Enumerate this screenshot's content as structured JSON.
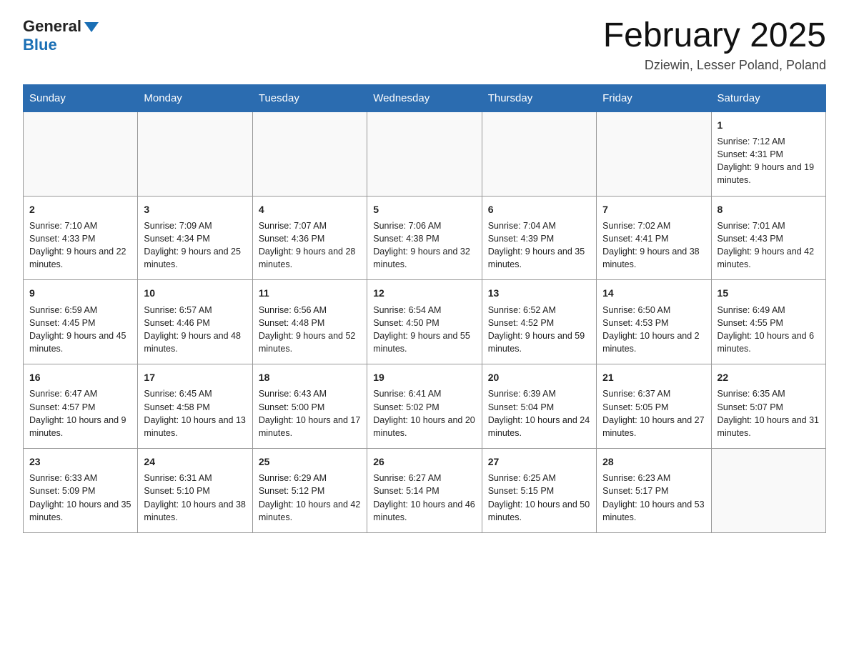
{
  "logo": {
    "top": "General",
    "bottom": "Blue"
  },
  "title": "February 2025",
  "subtitle": "Dziewin, Lesser Poland, Poland",
  "days_of_week": [
    "Sunday",
    "Monday",
    "Tuesday",
    "Wednesday",
    "Thursday",
    "Friday",
    "Saturday"
  ],
  "weeks": [
    [
      {
        "day": "",
        "info": ""
      },
      {
        "day": "",
        "info": ""
      },
      {
        "day": "",
        "info": ""
      },
      {
        "day": "",
        "info": ""
      },
      {
        "day": "",
        "info": ""
      },
      {
        "day": "",
        "info": ""
      },
      {
        "day": "1",
        "info": "Sunrise: 7:12 AM\nSunset: 4:31 PM\nDaylight: 9 hours and 19 minutes."
      }
    ],
    [
      {
        "day": "2",
        "info": "Sunrise: 7:10 AM\nSunset: 4:33 PM\nDaylight: 9 hours and 22 minutes."
      },
      {
        "day": "3",
        "info": "Sunrise: 7:09 AM\nSunset: 4:34 PM\nDaylight: 9 hours and 25 minutes."
      },
      {
        "day": "4",
        "info": "Sunrise: 7:07 AM\nSunset: 4:36 PM\nDaylight: 9 hours and 28 minutes."
      },
      {
        "day": "5",
        "info": "Sunrise: 7:06 AM\nSunset: 4:38 PM\nDaylight: 9 hours and 32 minutes."
      },
      {
        "day": "6",
        "info": "Sunrise: 7:04 AM\nSunset: 4:39 PM\nDaylight: 9 hours and 35 minutes."
      },
      {
        "day": "7",
        "info": "Sunrise: 7:02 AM\nSunset: 4:41 PM\nDaylight: 9 hours and 38 minutes."
      },
      {
        "day": "8",
        "info": "Sunrise: 7:01 AM\nSunset: 4:43 PM\nDaylight: 9 hours and 42 minutes."
      }
    ],
    [
      {
        "day": "9",
        "info": "Sunrise: 6:59 AM\nSunset: 4:45 PM\nDaylight: 9 hours and 45 minutes."
      },
      {
        "day": "10",
        "info": "Sunrise: 6:57 AM\nSunset: 4:46 PM\nDaylight: 9 hours and 48 minutes."
      },
      {
        "day": "11",
        "info": "Sunrise: 6:56 AM\nSunset: 4:48 PM\nDaylight: 9 hours and 52 minutes."
      },
      {
        "day": "12",
        "info": "Sunrise: 6:54 AM\nSunset: 4:50 PM\nDaylight: 9 hours and 55 minutes."
      },
      {
        "day": "13",
        "info": "Sunrise: 6:52 AM\nSunset: 4:52 PM\nDaylight: 9 hours and 59 minutes."
      },
      {
        "day": "14",
        "info": "Sunrise: 6:50 AM\nSunset: 4:53 PM\nDaylight: 10 hours and 2 minutes."
      },
      {
        "day": "15",
        "info": "Sunrise: 6:49 AM\nSunset: 4:55 PM\nDaylight: 10 hours and 6 minutes."
      }
    ],
    [
      {
        "day": "16",
        "info": "Sunrise: 6:47 AM\nSunset: 4:57 PM\nDaylight: 10 hours and 9 minutes."
      },
      {
        "day": "17",
        "info": "Sunrise: 6:45 AM\nSunset: 4:58 PM\nDaylight: 10 hours and 13 minutes."
      },
      {
        "day": "18",
        "info": "Sunrise: 6:43 AM\nSunset: 5:00 PM\nDaylight: 10 hours and 17 minutes."
      },
      {
        "day": "19",
        "info": "Sunrise: 6:41 AM\nSunset: 5:02 PM\nDaylight: 10 hours and 20 minutes."
      },
      {
        "day": "20",
        "info": "Sunrise: 6:39 AM\nSunset: 5:04 PM\nDaylight: 10 hours and 24 minutes."
      },
      {
        "day": "21",
        "info": "Sunrise: 6:37 AM\nSunset: 5:05 PM\nDaylight: 10 hours and 27 minutes."
      },
      {
        "day": "22",
        "info": "Sunrise: 6:35 AM\nSunset: 5:07 PM\nDaylight: 10 hours and 31 minutes."
      }
    ],
    [
      {
        "day": "23",
        "info": "Sunrise: 6:33 AM\nSunset: 5:09 PM\nDaylight: 10 hours and 35 minutes."
      },
      {
        "day": "24",
        "info": "Sunrise: 6:31 AM\nSunset: 5:10 PM\nDaylight: 10 hours and 38 minutes."
      },
      {
        "day": "25",
        "info": "Sunrise: 6:29 AM\nSunset: 5:12 PM\nDaylight: 10 hours and 42 minutes."
      },
      {
        "day": "26",
        "info": "Sunrise: 6:27 AM\nSunset: 5:14 PM\nDaylight: 10 hours and 46 minutes."
      },
      {
        "day": "27",
        "info": "Sunrise: 6:25 AM\nSunset: 5:15 PM\nDaylight: 10 hours and 50 minutes."
      },
      {
        "day": "28",
        "info": "Sunrise: 6:23 AM\nSunset: 5:17 PM\nDaylight: 10 hours and 53 minutes."
      },
      {
        "day": "",
        "info": ""
      }
    ]
  ]
}
